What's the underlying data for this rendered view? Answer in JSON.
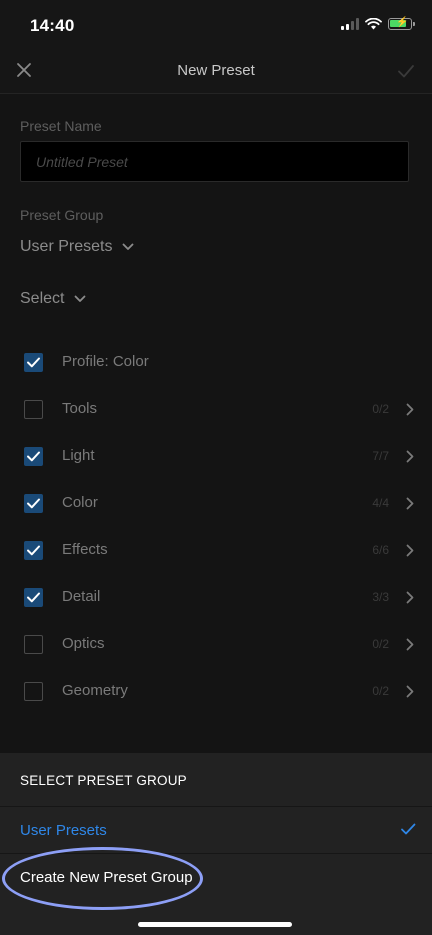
{
  "status_bar": {
    "time": "14:40"
  },
  "nav": {
    "title": "New Preset"
  },
  "form": {
    "preset_name_label": "Preset Name",
    "preset_name_placeholder": "Untitled Preset",
    "preset_group_label": "Preset Group",
    "preset_group_value": "User Presets",
    "select_label": "Select"
  },
  "options": [
    {
      "label": "Profile: Color",
      "checked": true,
      "count": ""
    },
    {
      "label": "Tools",
      "checked": false,
      "count": "0/2"
    },
    {
      "label": "Light",
      "checked": true,
      "count": "7/7"
    },
    {
      "label": "Color",
      "checked": true,
      "count": "4/4"
    },
    {
      "label": "Effects",
      "checked": true,
      "count": "6/6"
    },
    {
      "label": "Detail",
      "checked": true,
      "count": "3/3"
    },
    {
      "label": "Optics",
      "checked": false,
      "count": "0/2"
    },
    {
      "label": "Geometry",
      "checked": false,
      "count": "0/2"
    }
  ],
  "sheet": {
    "title": "SELECT PRESET GROUP",
    "selected_option": "User Presets",
    "create_option": "Create New Preset Group"
  },
  "colors": {
    "accent": "#2f87e8",
    "highlight": "#8d9ff6",
    "checkbox_on": "#1a4a78",
    "battery": "#4cd964"
  }
}
